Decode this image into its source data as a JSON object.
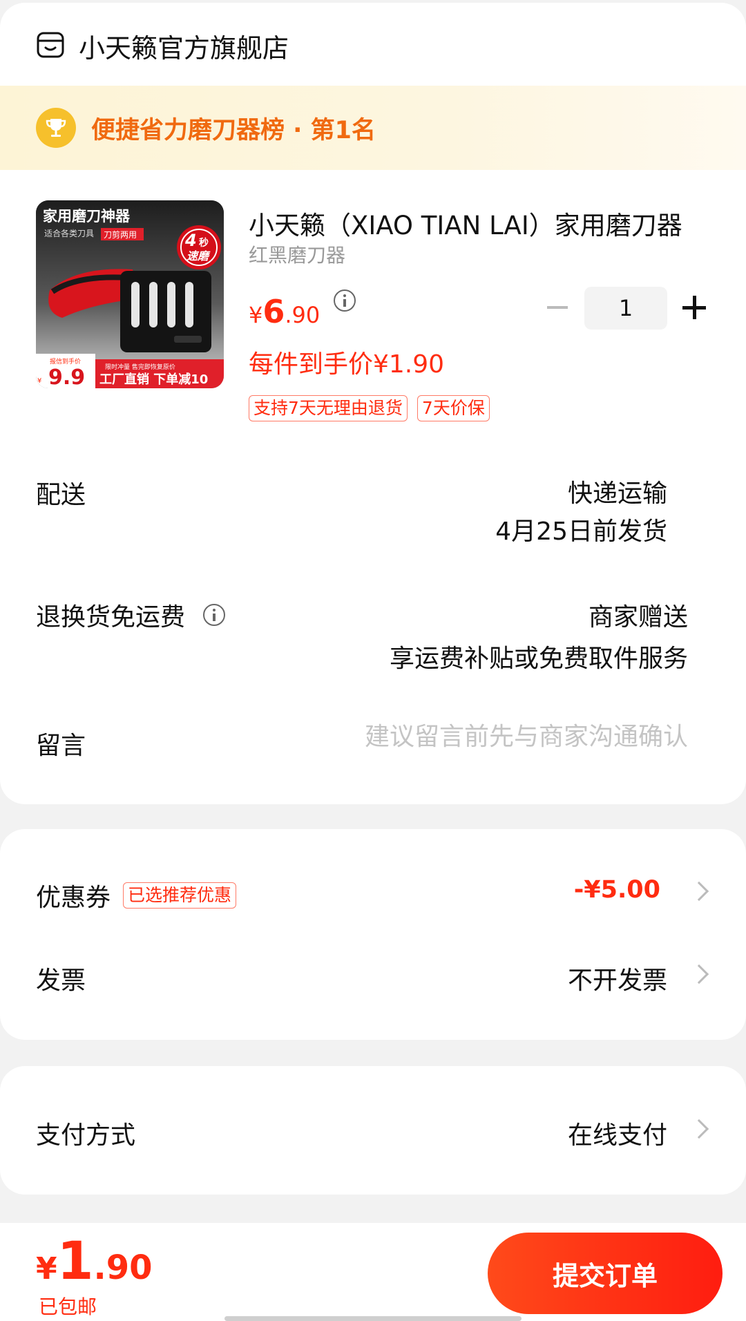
{
  "store": {
    "name": "小天籁官方旗舰店",
    "icon": "store-icon"
  },
  "rank": {
    "text": "便捷省力磨刀器榜 · 第1名",
    "icon": "trophy-icon"
  },
  "product": {
    "title": "小天籁（XIAO TIAN LAI）家用磨刀器",
    "sku": "红黑磨刀器",
    "price_symbol": "¥",
    "price_int": "6",
    "price_dec": ".90",
    "unit_price": "每件到手价¥1.90",
    "quantity": "1",
    "tags": [
      "支持7天无理由退货",
      "7天价保"
    ],
    "image": {
      "headline": "家用磨刀神器",
      "sub": "适合各类刀具",
      "badge": "刀剪两用",
      "speed_num": "4",
      "speed_unit": "秒",
      "speed_text": "速磨",
      "promo_price_label": "报信到手价",
      "promo_price": "9.9",
      "banner_small": "限时冲量 售完即恢复原价",
      "banner": "工厂直销 下单减10"
    }
  },
  "shipping": {
    "label": "配送",
    "method": "快递运输",
    "date": "4月25日前发货"
  },
  "returns": {
    "label": "退换货免运费",
    "value1": "商家赠送",
    "value2": "享运费补贴或免费取件服务"
  },
  "message": {
    "label": "留言",
    "placeholder": "建议留言前先与商家沟通确认"
  },
  "coupon": {
    "label": "优惠券",
    "tag": "已选推荐优惠",
    "value": "-¥5.00"
  },
  "invoice": {
    "label": "发票",
    "value": "不开发票"
  },
  "payment": {
    "label": "支付方式",
    "value": "在线支付"
  },
  "footer": {
    "total_symbol": "¥",
    "total_int": "1",
    "total_dec": ".90",
    "shipping_note": "已包邮",
    "submit_label": "提交订单"
  },
  "colors": {
    "accent": "#ff2c10",
    "rank_text": "#f06a10",
    "trophy": "#f6c02c"
  }
}
